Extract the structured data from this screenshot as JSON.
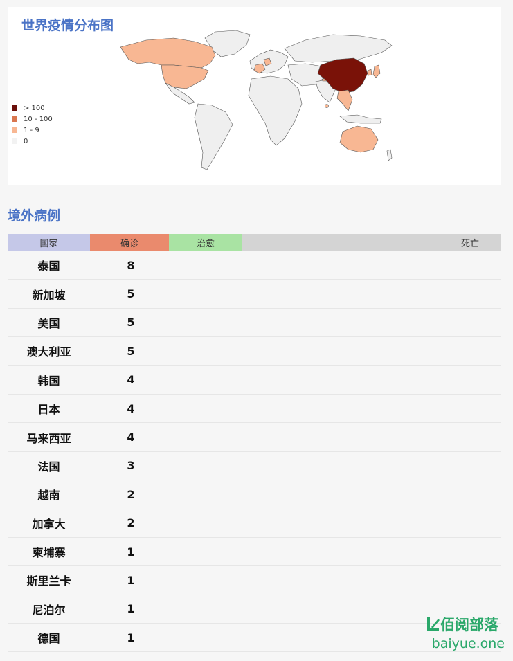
{
  "map": {
    "title": "世界疫情分布图",
    "legend": [
      {
        "label": "> 100",
        "color": "#6b0f0a"
      },
      {
        "label": "10 - 100",
        "color": "#d9764f"
      },
      {
        "label": "1 - 9",
        "color": "#f8b793"
      },
      {
        "label": "0",
        "color": "#f2f2f2"
      }
    ],
    "colors": {
      "level_high": "#7a1208",
      "level_mid": "#d9764f",
      "level_low": "#f8b793",
      "level_zero": "#efefef"
    }
  },
  "overseas": {
    "title": "境外病例",
    "headers": {
      "country": "国家",
      "confirmed": "确诊",
      "recovered": "治愈",
      "deaths": "死亡"
    },
    "rows": [
      {
        "country": "泰国",
        "confirmed": "8"
      },
      {
        "country": "新加坡",
        "confirmed": "5"
      },
      {
        "country": "美国",
        "confirmed": "5"
      },
      {
        "country": "澳大利亚",
        "confirmed": "5"
      },
      {
        "country": "韩国",
        "confirmed": "4"
      },
      {
        "country": "日本",
        "confirmed": "4"
      },
      {
        "country": "马来西亚",
        "confirmed": "4"
      },
      {
        "country": "法国",
        "confirmed": "3"
      },
      {
        "country": "越南",
        "confirmed": "2"
      },
      {
        "country": "加拿大",
        "confirmed": "2"
      },
      {
        "country": "柬埔寨",
        "confirmed": "1"
      },
      {
        "country": "斯里兰卡",
        "confirmed": "1"
      },
      {
        "country": "尼泊尔",
        "confirmed": "1"
      },
      {
        "country": "德国",
        "confirmed": "1"
      }
    ]
  },
  "watermark": {
    "name": "佰阅部落",
    "domain": "baiyue.one"
  }
}
